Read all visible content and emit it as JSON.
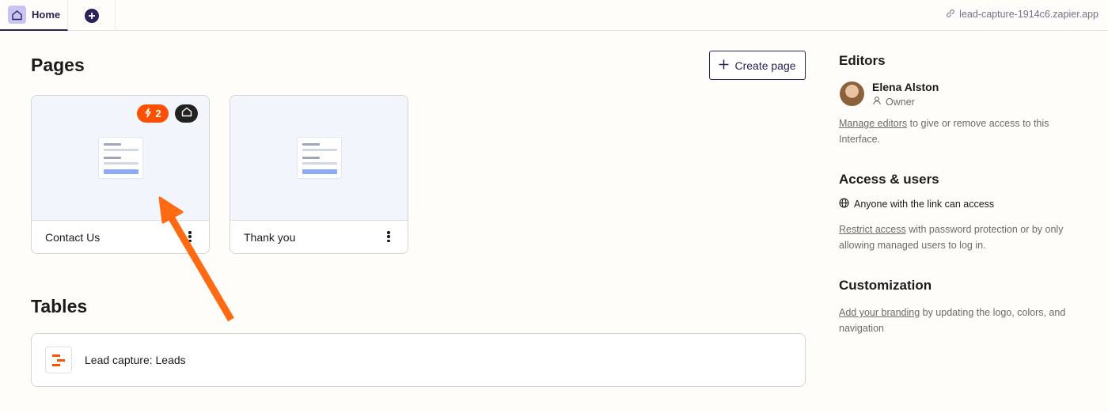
{
  "topbar": {
    "home_tab": "Home",
    "add_tab_icon": "plus-circle-icon",
    "app_url": "lead-capture-1914c6.zapier.app"
  },
  "pages": {
    "heading": "Pages",
    "create_label": "Create page",
    "cards": [
      {
        "name": "Contact Us",
        "zap_count": "2",
        "is_home": true
      },
      {
        "name": "Thank you"
      }
    ]
  },
  "tables": {
    "heading": "Tables",
    "items": [
      {
        "name": "Lead capture: Leads"
      }
    ]
  },
  "sidebar": {
    "editors": {
      "heading": "Editors",
      "name": "Elena Alston",
      "role": "Owner",
      "link": "Manage editors",
      "text": " to give or remove access to this Interface."
    },
    "access": {
      "heading": "Access & users",
      "status": "Anyone with the link can access",
      "link": "Restrict access",
      "text": " with password protection or by only allowing managed users to log in."
    },
    "customization": {
      "heading": "Customization",
      "link": "Add your branding",
      "text": " by updating the logo, colors, and navigation"
    }
  },
  "colors": {
    "accent": "#2b2358",
    "zapier_orange": "#ff4f00",
    "annotation_arrow": "#ff6a13"
  }
}
